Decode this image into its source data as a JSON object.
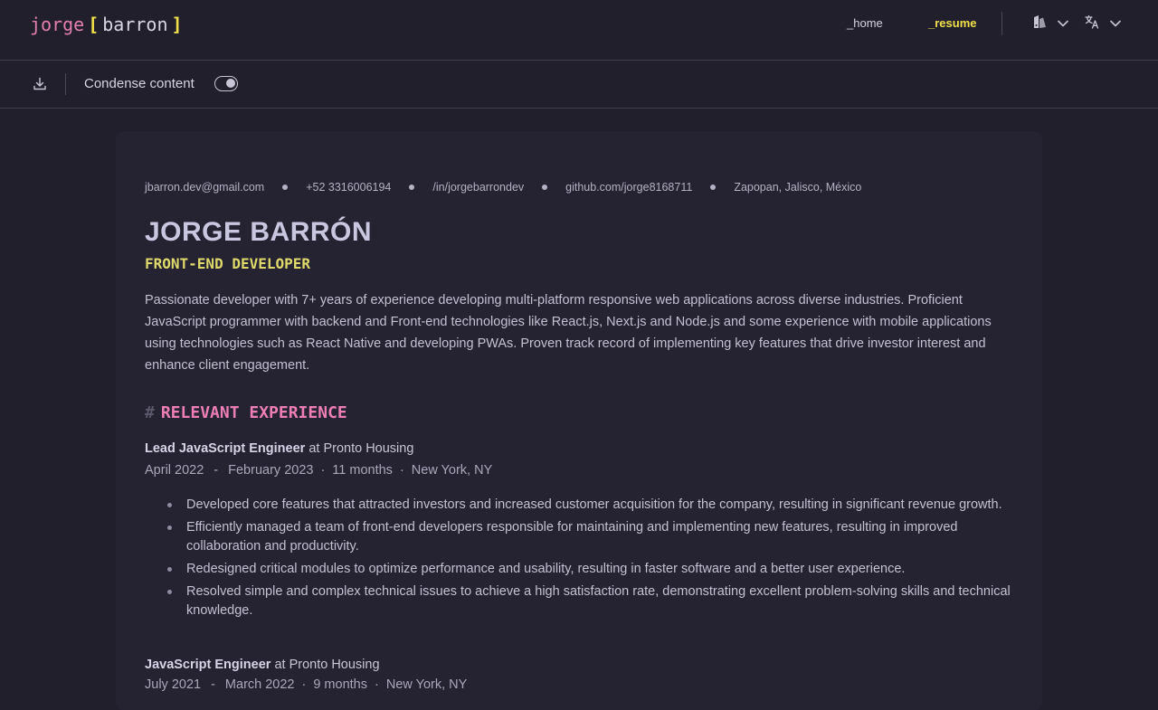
{
  "header": {
    "logo": {
      "first": "jorge",
      "open_bracket": "[",
      "last": "barron",
      "close_bracket": "]"
    },
    "nav": {
      "home": "_home",
      "resume": "_resume"
    },
    "theme_icon": "theme-palette-icon",
    "language_icon": "translate-icon"
  },
  "toolbar": {
    "download_icon": "download-icon",
    "condense_label": "Condense content",
    "condense_enabled": true
  },
  "resume": {
    "contact": {
      "email": "jbarron.dev@gmail.com",
      "phone": "+52 3316006194",
      "linkedin": "/in/jorgebarrondev",
      "github": "github.com/jorge8168711",
      "location": "Zapopan, Jalisco, México"
    },
    "name": "JORGE BARRÓN",
    "role": "FRONT-END DEVELOPER",
    "summary": "Passionate developer with 7+ years of experience developing multi-platform responsive web applications across diverse industries. Proficient JavaScript programmer with backend and Front-end technologies like React.js, Next.js and Node.js and some experience with mobile applications using technologies such as React Native and developing PWAs. Proven track record of implementing key features that drive investor interest and enhance client engagement.",
    "experience": {
      "hash": "#",
      "title": "RELEVANT EXPERIENCE",
      "jobs": [
        {
          "title": "Lead JavaScript Engineer",
          "at": "at",
          "company": "Pronto Housing",
          "start": "April 2022",
          "dash": "-",
          "end": "February 2023",
          "dot": "·",
          "duration": "11 months",
          "location": "New York, NY",
          "bullets": [
            "Developed core features that attracted investors and increased customer acquisition for the company, resulting in significant revenue growth.",
            "Efficiently managed a team of front-end developers responsible for maintaining and implementing new features, resulting in improved collaboration and productivity.",
            "Redesigned critical modules to optimize performance and usability, resulting in faster software and a better user experience.",
            "Resolved simple and complex technical issues to achieve a high satisfaction rate, demonstrating excellent problem-solving skills and technical knowledge."
          ]
        },
        {
          "title": "JavaScript Engineer",
          "at": "at",
          "company": "Pronto Housing",
          "start": "July 2021",
          "dash": "-",
          "end": "March 2022",
          "dot": "·",
          "duration": "9 months",
          "location": "New York, NY"
        }
      ]
    }
  },
  "colors": {
    "background": "#211f2c",
    "card": "#252332",
    "accent_yellow": "#f0e04a",
    "accent_pink": "#ee7fb6"
  }
}
